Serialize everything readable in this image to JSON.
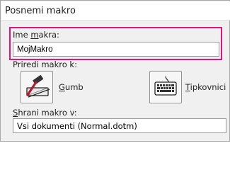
{
  "dialog": {
    "title": "Posnemi makro",
    "macro_name_label": {
      "prefix": "Ime ",
      "mnemonic": "m",
      "suffix": "akra:"
    },
    "macro_name_value": "MojMakro",
    "assign_label": "Priredi makro k:",
    "button_option": {
      "mnemonic": "G",
      "suffix": "umb"
    },
    "keyboard_option": {
      "mnemonic": "T",
      "suffix": "ipkovnici"
    },
    "store_label": {
      "mnemonic": "S",
      "suffix": "hrani makro v:"
    },
    "store_value": "Vsi dokumenti (Normal.dotm)"
  },
  "colors": {
    "highlight": "#e0157f"
  }
}
